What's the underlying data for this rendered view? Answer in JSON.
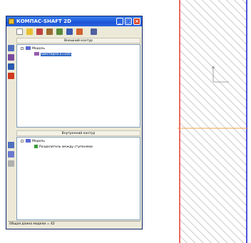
{
  "window": {
    "title": "КОМПАС-SHAFT 2D"
  },
  "outer": {
    "header": "Внешний контур",
    "root_label": "Модель",
    "child_label": "Шестерня Z=105"
  },
  "inner": {
    "header": "Внутренний контур",
    "root_label": "Модель",
    "child_label": "Разделитель между ступенями"
  },
  "status": {
    "text": "Общая длина модели = 42"
  },
  "colors": {
    "selection": "#316ac5",
    "left_line": "#e8453c",
    "right_line": "#1e2bd0",
    "center_line": "#f0a050",
    "hatch": "#aaaaaa"
  },
  "icons": {
    "toolbar": [
      "new-file-icon",
      "open-folder-icon",
      "layers-icon",
      "tools-icon",
      "settings-icon",
      "shaft-icon",
      "gear-icon",
      "blueprint-icon"
    ],
    "outer_side": [
      "step-icon",
      "gear-icon",
      "assembly-icon",
      "dimension-icon"
    ],
    "inner_side": [
      "step-icon",
      "bore-icon",
      "gray-step-icon"
    ]
  }
}
